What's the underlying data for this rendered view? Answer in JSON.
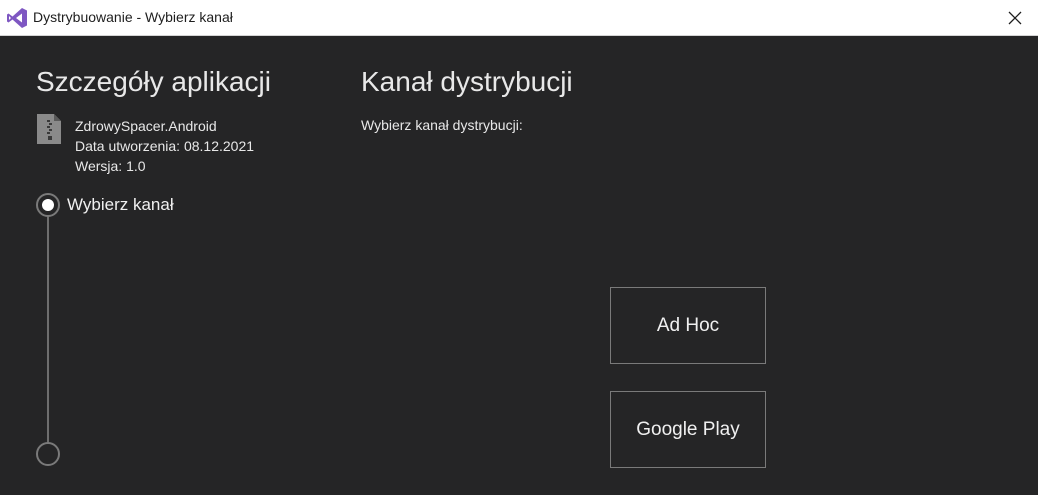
{
  "window": {
    "title": "Dystrybuowanie - Wybierz kanał",
    "accent_color": "#68217a"
  },
  "app_details": {
    "heading": "Szczegóły aplikacji",
    "name": "ZdrowySpacer.Android",
    "created": "Data utworzenia: 08.12.2021",
    "version": "Wersja: 1.0",
    "icon": "zip-file-icon"
  },
  "steps": [
    {
      "label": "Wybierz kanał",
      "state": "active"
    },
    {
      "label": "",
      "state": "pending"
    }
  ],
  "distribution": {
    "heading": "Kanał dystrybucji",
    "prompt": "Wybierz kanał dystrybucji:",
    "channels": [
      {
        "label": "Ad Hoc"
      },
      {
        "label": "Google Play"
      }
    ]
  }
}
